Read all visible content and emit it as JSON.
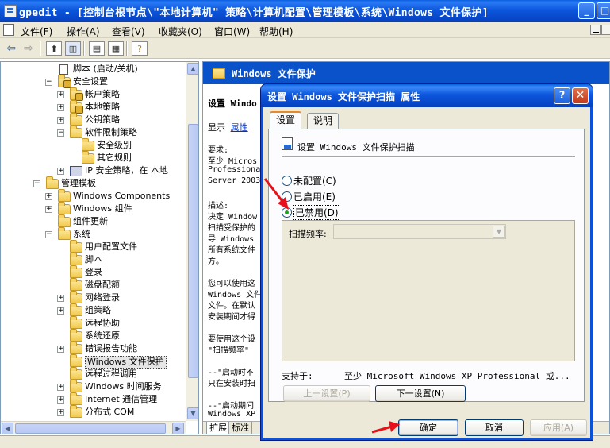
{
  "window": {
    "title": "gpedit - [控制台根节点\\\"本地计算机\" 策略\\计算机配置\\管理模板\\系统\\Windows 文件保护]",
    "minimize": "_",
    "maximize": "□"
  },
  "menu": [
    {
      "label": "文件(F)"
    },
    {
      "label": "操作(A)"
    },
    {
      "label": "查看(V)"
    },
    {
      "label": "收藏夹(O)"
    },
    {
      "label": "窗口(W)"
    },
    {
      "label": "帮助(H)"
    }
  ],
  "toolbar": {
    "back_icon": "back-arrow-icon",
    "forward_icon": "forward-arrow-icon",
    "up_icon": "up-folder-icon",
    "show_hide_icon": "show-hide-tree-icon",
    "export_icon": "export-list-icon",
    "properties_icon": "properties-icon",
    "help_icon": "help-icon"
  },
  "tree": {
    "items": [
      {
        "label": "脚本 (启动/关机)",
        "icon": "doc"
      },
      {
        "label": "安全设置",
        "icon": "lock-folder",
        "expander": "−"
      },
      {
        "label": "帐户策略",
        "icon": "lock-folder",
        "expander": "+"
      },
      {
        "label": "本地策略",
        "icon": "lock-folder",
        "expander": "+"
      },
      {
        "label": "公钥策略",
        "icon": "folder",
        "expander": "+"
      },
      {
        "label": "软件限制策略",
        "icon": "folder",
        "expander": "−"
      },
      {
        "label": "安全级别",
        "icon": "folder"
      },
      {
        "label": "其它规则",
        "icon": "folder"
      },
      {
        "label": "IP 安全策略，在 本地",
        "icon": "pc",
        "expander": "+"
      },
      {
        "label": "管理模板",
        "icon": "folder",
        "expander": "−"
      },
      {
        "label": "Windows Components",
        "icon": "folder",
        "expander": "+"
      },
      {
        "label": "Windows 组件",
        "icon": "folder",
        "expander": "+"
      },
      {
        "label": "组件更新",
        "icon": "folder"
      },
      {
        "label": "系统",
        "icon": "folder",
        "expander": "−"
      },
      {
        "label": "用户配置文件",
        "icon": "folder"
      },
      {
        "label": "脚本",
        "icon": "folder"
      },
      {
        "label": "登录",
        "icon": "folder"
      },
      {
        "label": "磁盘配额",
        "icon": "folder"
      },
      {
        "label": "网络登录",
        "icon": "folder",
        "expander": "+"
      },
      {
        "label": "组策略",
        "icon": "folder",
        "expander": "+"
      },
      {
        "label": "远程协助",
        "icon": "folder"
      },
      {
        "label": "系统还原",
        "icon": "folder"
      },
      {
        "label": "错误报告功能",
        "icon": "folder",
        "expander": "+"
      },
      {
        "label": "Windows 文件保护",
        "icon": "folder",
        "selected": true
      },
      {
        "label": "远程过程调用",
        "icon": "folder"
      },
      {
        "label": "Windows 时间服务",
        "icon": "folder",
        "expander": "+"
      },
      {
        "label": "Internet 通信管理",
        "icon": "folder",
        "expander": "+"
      },
      {
        "label": "分布式 COM",
        "icon": "folder",
        "expander": "+"
      }
    ]
  },
  "details": {
    "header": "Windows 文件保护",
    "setting_title": "设置 Windo",
    "display_label": "显示",
    "display_link": "属性",
    "requirements_label": "要求:",
    "requirements_lines": [
      "至少 Micros",
      "Professiona",
      "Server 2003"
    ],
    "description_label": "描述:",
    "description_lines": [
      "决定 Window",
      "扫描受保护的",
      "导 Windows",
      "所有系统文件",
      "方。"
    ],
    "para2_lines": [
      "您可以使用这",
      "Windows 文件",
      "文件。在默认",
      "安装期间才得"
    ],
    "para3_lines": [
      "要使用这个设",
      "\"扫描频率\""
    ],
    "para4_lines": [
      "--\"启动时不",
      "只在安装时扫"
    ],
    "para5_lines": [
      "--\"启动期间",
      "Windows XP"
    ],
    "ext_tabs": [
      "扩展",
      "标准"
    ]
  },
  "dialog": {
    "title": "设置 Windows 文件保护扫描 属性",
    "help": "?",
    "close": "✕",
    "tabs": [
      "设置",
      "说明"
    ],
    "setting_name": "设置 Windows 文件保护扫描",
    "options": [
      {
        "label": "未配置(C)",
        "checked": false
      },
      {
        "label": "已启用(E)",
        "checked": false
      },
      {
        "label": "已禁用(D)",
        "checked": true
      }
    ],
    "frequency_label": "扫描频率:",
    "frequency_value": "",
    "supported_label": "支持于:",
    "supported_value": "至少 Microsoft Windows XP Professional 或...",
    "prev_button": "上一设置(P)",
    "next_button": "下一设置(N)",
    "ok_button": "确定",
    "cancel_button": "取消",
    "apply_button": "应用(A)"
  },
  "colors": {
    "title_bar": "#0846c8",
    "annotation_arrow": "#e8101a",
    "radio_checked": "#21a121"
  }
}
